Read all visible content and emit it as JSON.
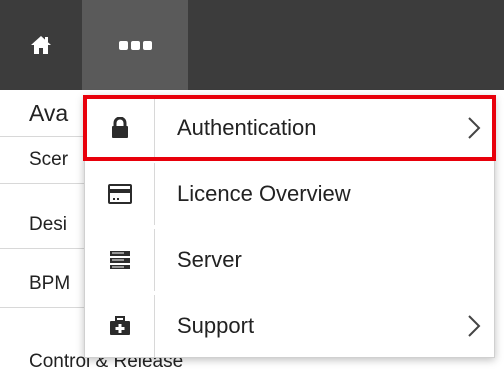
{
  "topbar": {
    "home_icon": "home-icon",
    "more_icon": "more-horizontal-icon"
  },
  "background_list": {
    "items": [
      {
        "label": "Ava"
      },
      {
        "label": "Scer"
      },
      {
        "label": "Desi"
      },
      {
        "label": "BPM"
      },
      {
        "label": "Control & Release"
      }
    ]
  },
  "menu": {
    "items": [
      {
        "label": "Authentication",
        "icon": "lock-icon",
        "has_submenu": true,
        "highlighted": true
      },
      {
        "label": "Licence Overview",
        "icon": "credit-card-icon",
        "has_submenu": false
      },
      {
        "label": "Server",
        "icon": "server-icon",
        "has_submenu": false
      },
      {
        "label": "Support",
        "icon": "first-aid-kit-icon",
        "has_submenu": true
      }
    ]
  },
  "colors": {
    "topbar": "#3c3c3c",
    "active_tab": "#5a5a5a",
    "highlight_border": "#e8000b",
    "icon": "#2b2b2b"
  }
}
